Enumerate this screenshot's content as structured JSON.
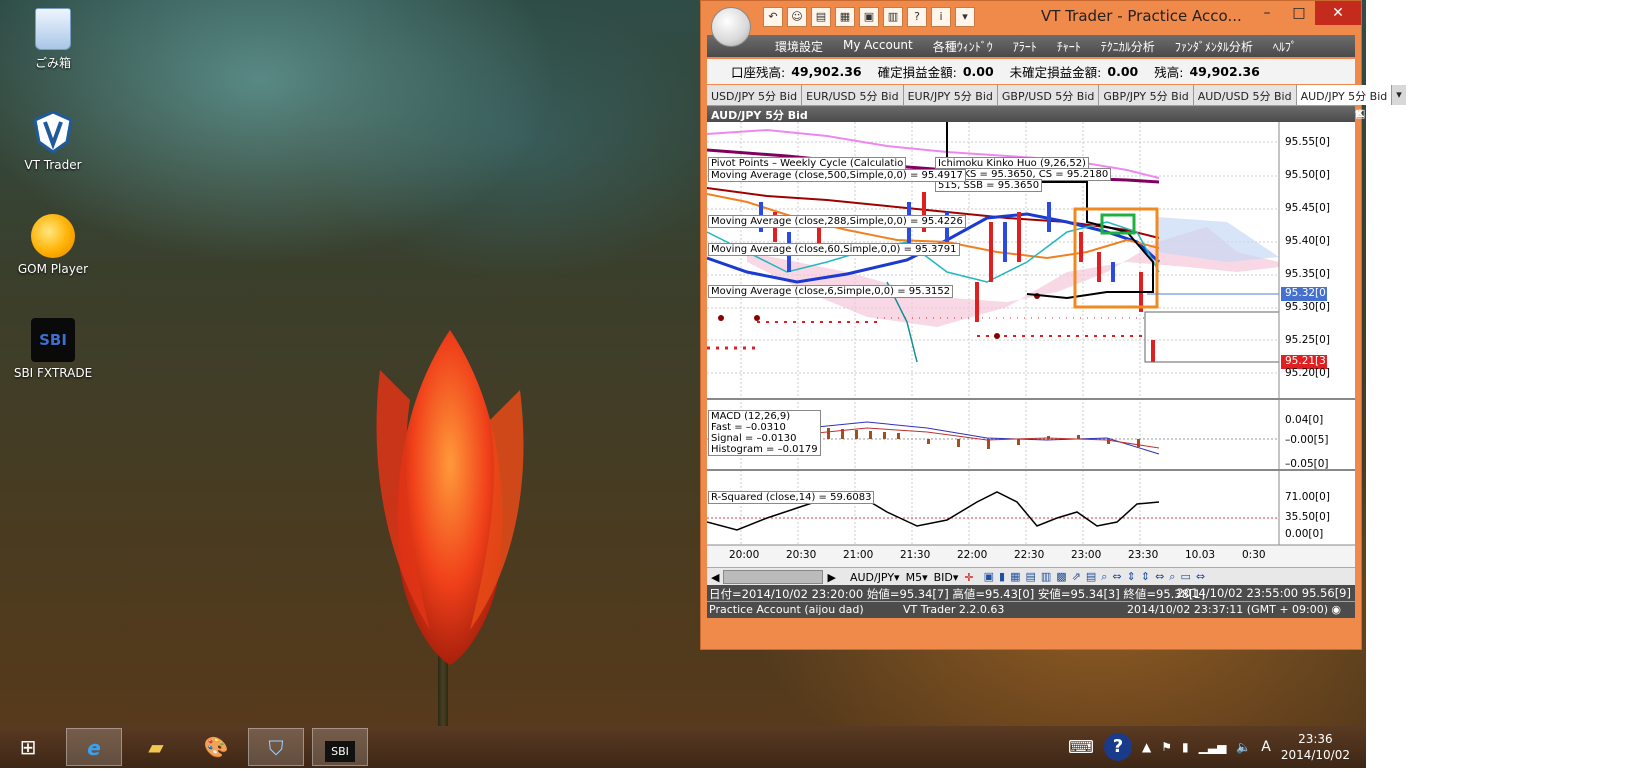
{
  "desktop": {
    "icons": [
      {
        "label": "ごみ箱",
        "icon": "recycle-bin-icon"
      },
      {
        "label": "VT Trader",
        "icon": "vt-trader-icon"
      },
      {
        "label": "GOM Player",
        "icon": "gom-player-icon"
      },
      {
        "label": "SBI FXTRADE",
        "icon": "sbi-fxtrade-icon"
      }
    ]
  },
  "window": {
    "title": "VT Trader - Practice Acco...",
    "controls": {
      "minimize": "–",
      "maximize": "□",
      "close": "✕"
    },
    "menu": [
      "環境設定",
      "My Account",
      "各種ｳｨﾝﾄﾞｳ",
      "ｱﾗｰﾄ",
      "ﾁｬｰﾄ",
      "ﾃｸﾆｶﾙ分析",
      "ﾌｧﾝﾀﾞﾒﾝﾀﾙ分析",
      "ﾍﾙﾌﾟ"
    ],
    "balance": {
      "account_balance_label": "口座残高:",
      "account_balance": "49,902.36",
      "realized_pl_label": "確定損益金額:",
      "realized_pl": "0.00",
      "unrealized_pl_label": "未確定損益金額:",
      "unrealized_pl": "0.00",
      "balance_label": "残高:",
      "balance": "49,902.36"
    },
    "tabs": [
      "USD/JPY 5分 Bid",
      "EUR/USD 5分 Bid",
      "EUR/JPY 5分 Bid",
      "GBP/USD 5分 Bid",
      "GBP/JPY 5分 Bid",
      "AUD/USD 5分 Bid",
      "AUD/JPY 5分 Bid"
    ],
    "active_tab": "AUD/JPY 5分 Bid",
    "chart_title": "AUD/JPY 5分 Bid",
    "indicator_labels": [
      "Pivot Points – Weekly Cycle (Calculatio",
      "Ichimoku Kinko Huo (9,26,52)",
      "Moving Average (close,500,Simple,0,0) = 95.4917",
      "Moving Average (close,288,Simple,0,0) = 95.4226",
      "Moving Average (close,60,Simple,0,0) = 95.3791",
      "Moving Average (close,6,Simple,0,0) = 95.3152",
      "380, KS = 95.3650, CS = 95.2180",
      "515, SSB = 95.3650"
    ],
    "price_axis": [
      "95.55[0]",
      "95.50[0]",
      "95.45[0]",
      "95.40[0]",
      "95.35[0]",
      "95.32[0]",
      "95.30[0]",
      "95.25[0]",
      "95.21[3]",
      "95.20[0]"
    ],
    "macd": {
      "title": "MACD (12,26,9)",
      "fast": "Fast = –0.0310",
      "signal": "Signal = –0.0130",
      "histogram": "Histogram = –0.0179",
      "axis": [
        "0.04[0]",
        "–0.00[5]",
        "–0.05[0]"
      ]
    },
    "rsquared": {
      "title": "R-Squared (close,14) = 59.6083",
      "axis": [
        "71.00[0]",
        "35.50[0]",
        "0.00[0]"
      ]
    },
    "time_axis": [
      "20:00",
      "20:30",
      "21:00",
      "21:30",
      "22:00",
      "22:30",
      "23:00",
      "23:30",
      "10.03",
      "0:30"
    ],
    "toolbar": {
      "symbol": "AUD/JPY",
      "timeframe": "M5",
      "price_type": "BID"
    },
    "status_ohlc": "日付=2014/10/02 23:20:00 始値=95.34[7] 高値=95.43[0] 安値=95.34[3] 終値=95.38[1]",
    "status_right": "2014/10/02 23:55:00  95.56[9]",
    "status_account": "Practice Account (aijou dad)",
    "status_version": "VT Trader 2.2.0.63",
    "status_time": "2014/10/02 23:37:11 (GMT + 09:00)"
  },
  "taskbar": {
    "clock_time": "23:36",
    "clock_date": "2014/10/02",
    "ime": "A"
  }
}
